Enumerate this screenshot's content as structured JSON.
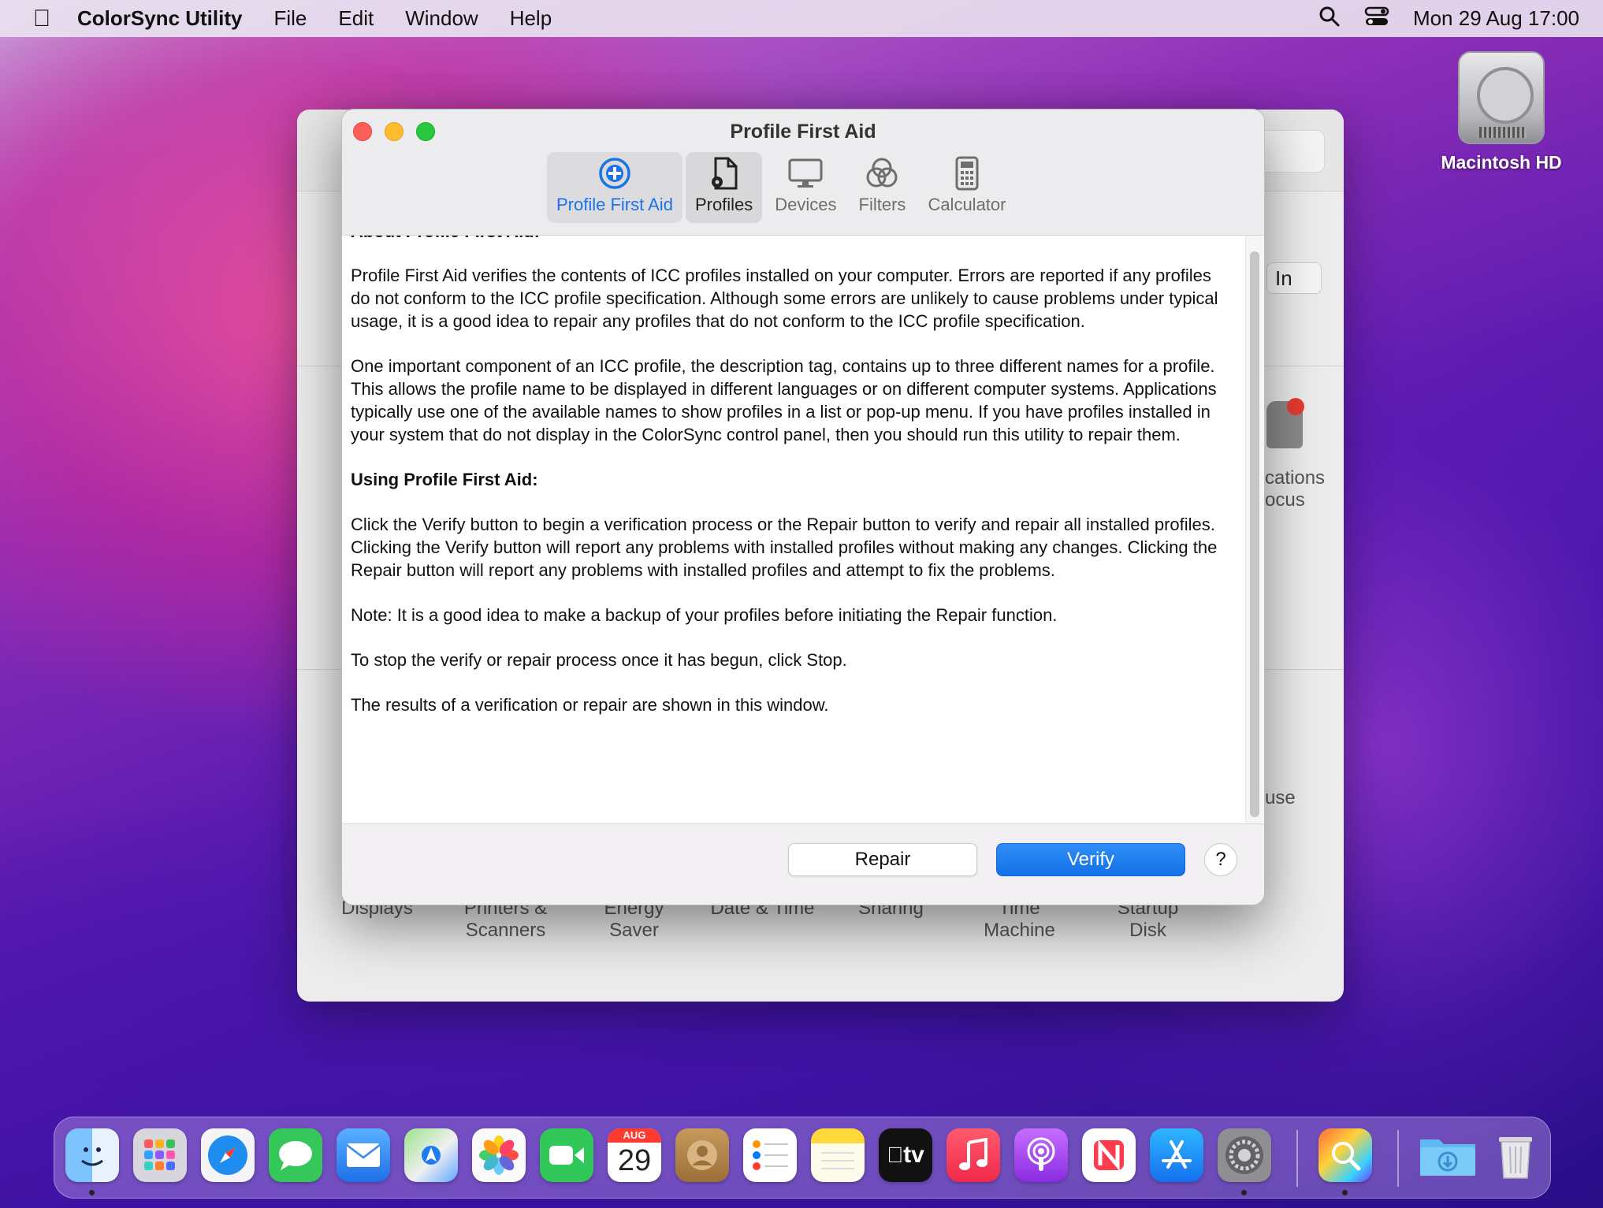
{
  "menubar": {
    "app_name": "ColorSync Utility",
    "menus": [
      "File",
      "Edit",
      "Window",
      "Help"
    ],
    "clock": "Mon 29 Aug  17:00"
  },
  "desktop": {
    "disk_label": "Macintosh HD"
  },
  "prefs_window": {
    "signin_fragment": "In",
    "fragment_notifications_1": "cations",
    "fragment_notifications_2": "ocus",
    "fragment_mouse": "use",
    "panes": [
      {
        "label": "Displays"
      },
      {
        "label": "Printers &\nScanners"
      },
      {
        "label": "Energy\nSaver"
      },
      {
        "label": "Date & Time"
      },
      {
        "label": "Sharing"
      },
      {
        "label": "Time\nMachine"
      },
      {
        "label": "Startup\nDisk"
      }
    ]
  },
  "dialog": {
    "title": "Profile First Aid",
    "toolbar": [
      {
        "label": "Profile First Aid",
        "icon": "plus-circle-icon",
        "state": "selected"
      },
      {
        "label": "Profiles",
        "icon": "document-gear-icon",
        "state": "hover"
      },
      {
        "label": "Devices",
        "icon": "monitor-icon",
        "state": "normal"
      },
      {
        "label": "Filters",
        "icon": "filters-icon",
        "state": "normal"
      },
      {
        "label": "Calculator",
        "icon": "calculator-icon",
        "state": "normal"
      }
    ],
    "cut_heading": "About Profile First Aid:",
    "paragraphs": [
      "Profile First Aid verifies the contents of ICC profiles installed on your computer. Errors are reported if any profiles do not conform to the ICC profile specification. Although some errors are unlikely to cause problems under typical usage, it is a good idea to repair any profiles that do not conform to the ICC profile specification.",
      "One important component of an ICC profile, the description tag, contains up to three different names for a profile. This allows the profile name to be displayed in different languages or on different computer systems. Applications typically use one of the available names to show profiles in a list or pop-up menu. If you have profiles installed in your system that do not display in the ColorSync control panel, then you should run this utility to repair them.",
      "Using Profile First Aid:",
      "Click the Verify button to begin a verification process or the Repair button to verify and repair all installed profiles. Clicking the Verify button will report any problems with installed profiles without making any changes. Clicking the Repair button will report any problems with installed profiles and attempt to fix the problems.",
      "Note: It is a good idea to make a backup of your profiles before initiating the Repair function.",
      "To stop the verify or repair process once it has begun, click Stop.",
      "The results of a verification or repair are shown in this window."
    ],
    "repair_label": "Repair",
    "verify_label": "Verify",
    "help_label": "?"
  },
  "dock": {
    "calendar_month": "AUG",
    "calendar_day": "29",
    "tv_label": "tv",
    "apps": [
      "finder",
      "launchpad",
      "safari",
      "messages",
      "mail",
      "maps",
      "photos",
      "facetime",
      "calendar",
      "contacts",
      "reminders",
      "notes",
      "tv",
      "music",
      "podcasts",
      "news",
      "app-store",
      "system-preferences",
      "colorsync-utility",
      "downloads",
      "trash"
    ]
  },
  "colors": {
    "accent": "#1a73e8",
    "verify_button": "#1470e6",
    "close": "#fe5f57",
    "minimize": "#febc2e",
    "maximize": "#28c840"
  }
}
